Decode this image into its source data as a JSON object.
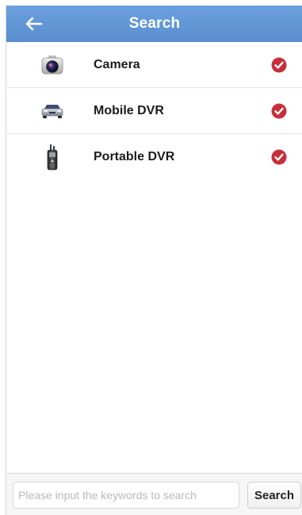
{
  "header": {
    "title": "Search",
    "back_icon": "back-arrow-icon"
  },
  "colors": {
    "header_bg": "#5f95d4",
    "check_accent": "#c62f3b"
  },
  "devices": [
    {
      "label": "Camera",
      "icon": "camera-icon",
      "checked": true
    },
    {
      "label": "Mobile DVR",
      "icon": "car-icon",
      "checked": true
    },
    {
      "label": "Portable DVR",
      "icon": "portable-dvr-icon",
      "checked": true
    }
  ],
  "search": {
    "value": "",
    "placeholder": "Please input the keywords to search",
    "button_label": "Search"
  }
}
